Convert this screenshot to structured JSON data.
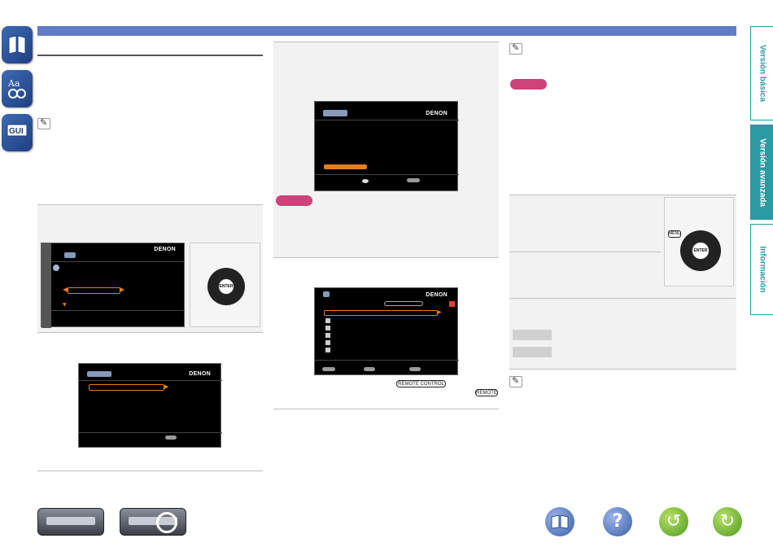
{
  "header": {
    "color": "#5f7cc6"
  },
  "side_icons": [
    {
      "name": "contents-book-icon"
    },
    {
      "name": "index-aa-icon"
    },
    {
      "name": "gui-icon",
      "label": "GUI"
    }
  ],
  "right_tabs": [
    {
      "label": "Versión básica",
      "active": false
    },
    {
      "label": "Versión avanzada",
      "active": true
    },
    {
      "label": "Información",
      "active": false
    }
  ],
  "screens": {
    "brand": "DENON",
    "s1_arrows": "◀  ▶",
    "s4_header_box": ""
  },
  "remote": {
    "enter_label": "ENTER",
    "menu_label": "MENU",
    "remote_control_label": "REMOTE CONTROL",
    "remote_label": "REMOTE"
  },
  "colors": {
    "accent_teal": "#2a9aa4",
    "note_pink": "#cc4479",
    "orange": "#e07f1c"
  }
}
